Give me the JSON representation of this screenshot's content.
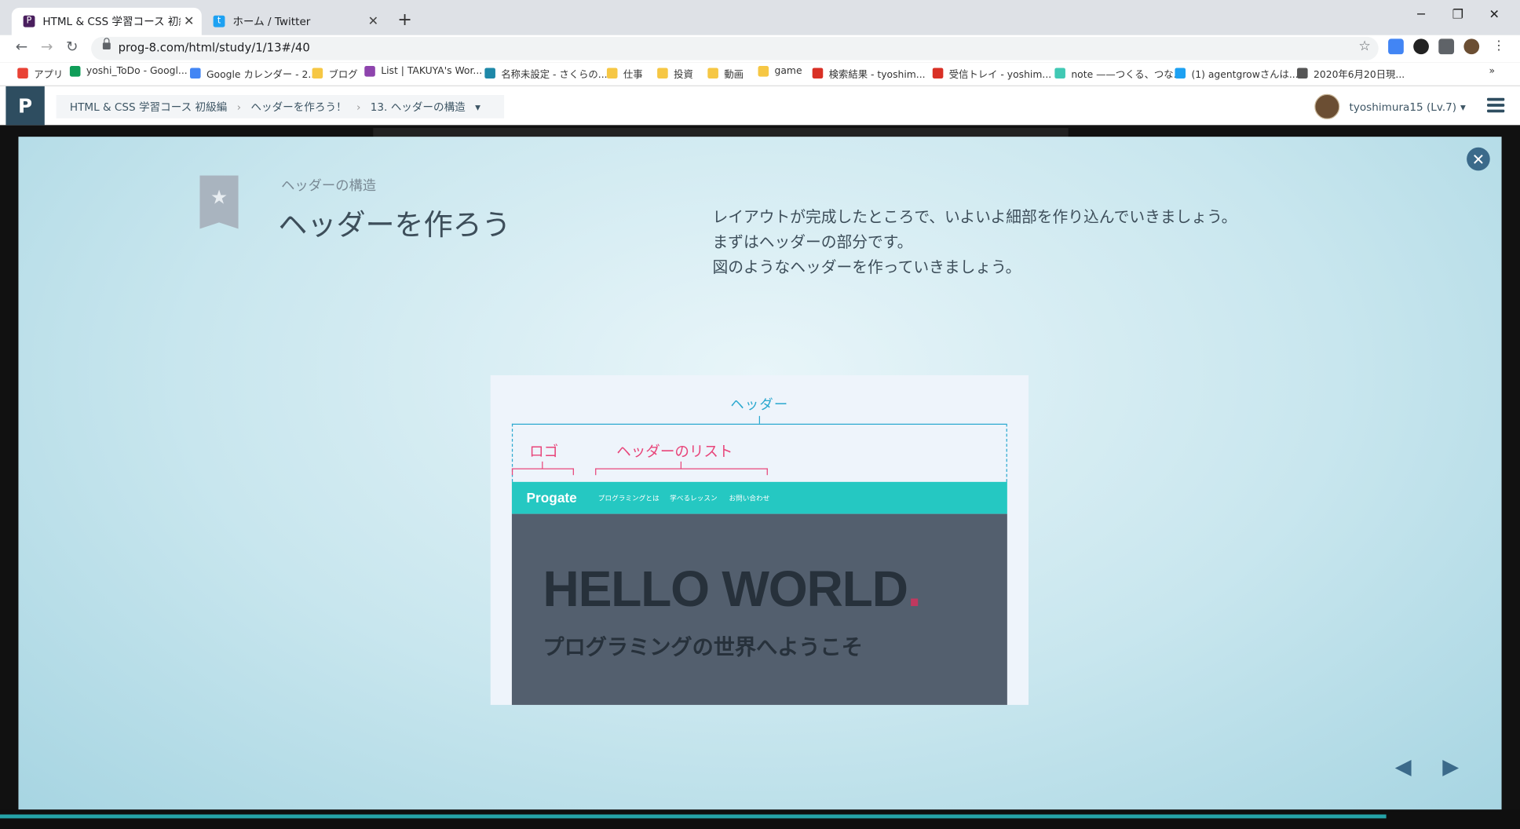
{
  "tabs": [
    {
      "title": "HTML & CSS 学習コース 初級編 | Pro",
      "color": "#4a1f5e",
      "icon": "P"
    },
    {
      "title": "ホーム / Twitter",
      "color": "#1da1f2",
      "icon": "t"
    }
  ],
  "window_controls": [
    "─",
    "❐",
    "✕"
  ],
  "url": "prog-8.com/html/study/1/13#/40",
  "bookmarks": [
    {
      "label": "アプリ",
      "color": "#e94235"
    },
    {
      "label": "yoshi_ToDo - Googl...",
      "color": "#0f9d58"
    },
    {
      "label": "Google カレンダー - 2...",
      "color": "#4285f4"
    },
    {
      "label": "ブログ",
      "color": "#f6c744"
    },
    {
      "label": "List | TAKUYA's Wor...",
      "color": "#8e44ad"
    },
    {
      "label": "名称未設定 - さくらの...",
      "color": "#1e88a8"
    },
    {
      "label": "仕事",
      "color": "#f6c744"
    },
    {
      "label": "投資",
      "color": "#f6c744"
    },
    {
      "label": "動画",
      "color": "#f6c744"
    },
    {
      "label": "game",
      "color": "#f6c744"
    },
    {
      "label": "検索結果 - tyoshim...",
      "color": "#d93025"
    },
    {
      "label": "受信トレイ - yoshim...",
      "color": "#d93025"
    },
    {
      "label": "note ——つくる、つな...",
      "color": "#41c9b4"
    },
    {
      "label": "(1) agentgrowさんは...",
      "color": "#1da1f2"
    },
    {
      "label": "2020年6月20日現...",
      "color": "#555555"
    }
  ],
  "more_bookmarks": "»",
  "breadcrumb": [
    "HTML & CSS 学習コース 初級編",
    "ヘッダーを作ろう！",
    "13. ヘッダーの構造"
  ],
  "user": "tyoshimura15 (Lv.7)",
  "slide": {
    "subtitle": "ヘッダーの構造",
    "title": "ヘッダーを作ろう",
    "description": [
      "レイアウトが完成したところで、いよいよ細部を作り込んでいきましょう。",
      "まずはヘッダーの部分です。",
      "図のようなヘッダーを作っていきましょう。"
    ]
  },
  "illustration": {
    "label_header": "ヘッダー",
    "label_logo": "ロゴ",
    "label_list": "ヘッダーのリスト",
    "brand": "Progate",
    "nav": [
      "プログラミングとは",
      "学べるレッスン",
      "お問い合わせ"
    ],
    "hello": "HELLO WORLD",
    "hello_dot": ".",
    "welcome": "プログラミングの世界へようこそ"
  },
  "colors": {
    "accent": "#25c8c2",
    "label_blue": "#2aa8cf",
    "label_pink": "#e8457a"
  }
}
